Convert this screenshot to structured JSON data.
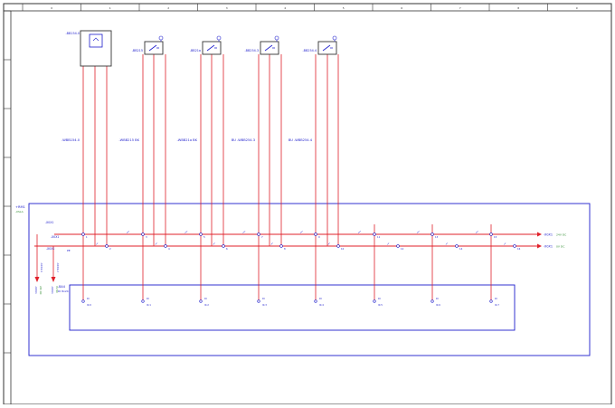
{
  "colors": {
    "frame": "#333333",
    "wire": "#e0202a",
    "device": "#1d1dcc",
    "label_green": "#2e8b2e",
    "arrow": "#e0202a"
  },
  "ruler": {
    "columns": [
      "0",
      "1",
      "2",
      "3",
      "4",
      "5",
      "6",
      "7",
      "8",
      "9"
    ]
  },
  "devices": [
    {
      "tag": "-BB154.0",
      "kind": "sensor"
    },
    {
      "tag": "-BB215",
      "kind": "switch"
    },
    {
      "tag": "-BB21a",
      "kind": "switch"
    },
    {
      "tag": "-BB254.3",
      "kind": "switch"
    },
    {
      "tag": "-BB254.4",
      "kind": "switch"
    }
  ],
  "cable_labels": [
    "-WBB154.0",
    "-WBB215 BK",
    "-WBB21a BK",
    "BU -WBB254.3",
    "BU -WBB254.4"
  ],
  "enclosure": {
    "tag": "+RM1",
    "sub": "-XSLA"
  },
  "terminal_strip": {
    "rows": [
      "-X0X1",
      "-X0X1",
      "-X0X1"
    ],
    "pe_label": "PE",
    "outputs": [
      {
        "tag": "-X0X1",
        "desc": "24V DC"
      },
      {
        "tag": "-X0X1",
        "desc": "0V DC"
      }
    ],
    "branches": [
      "-X0X1.1",
      "-X0X1.2"
    ]
  },
  "plc_card": {
    "tag": "-BA4",
    "sub": "DI 8x24",
    "channels": [
      {
        "addr": "DI",
        "io": "I0.0"
      },
      {
        "addr": "DI",
        "io": "I0.1"
      },
      {
        "addr": "DI",
        "io": "I0.2"
      },
      {
        "addr": "DI",
        "io": "I0.3"
      },
      {
        "addr": "DI",
        "io": "I0.4"
      },
      {
        "addr": "DI",
        "io": "I0.5"
      },
      {
        "addr": "DI",
        "io": "I0.6"
      },
      {
        "addr": "DI",
        "io": "I0.7"
      }
    ]
  }
}
